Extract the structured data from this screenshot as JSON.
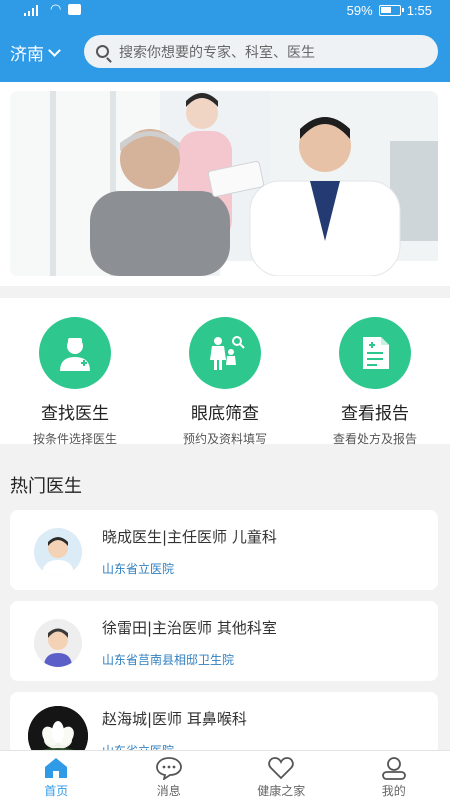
{
  "status": {
    "network": "4G",
    "battery": "59%",
    "time": "1:55"
  },
  "header": {
    "city": "济南",
    "search_placeholder": "搜索你想要的专家、科室、医生"
  },
  "features": [
    {
      "title": "查找医生",
      "subtitle": "按条件选择医生",
      "icon": "doctor-icon"
    },
    {
      "title": "眼底筛查",
      "subtitle": "预约及资料填写",
      "icon": "family-icon"
    },
    {
      "title": "查看报告",
      "subtitle": "查看处方及报告",
      "icon": "report-icon"
    }
  ],
  "hot_doctors": {
    "title": "热门医生",
    "items": [
      {
        "name": "晓成医生|主任医师 儿童科",
        "hospital": "山东省立医院"
      },
      {
        "name": "徐雷田|主治医师 其他科室",
        "hospital": "山东省莒南县相邸卫生院"
      },
      {
        "name": "赵海城|医师 耳鼻喉科",
        "hospital": "山东省立医院"
      }
    ]
  },
  "tabs": [
    {
      "label": "首页",
      "icon": "home-icon",
      "active": true
    },
    {
      "label": "消息",
      "icon": "message-icon",
      "active": false
    },
    {
      "label": "健康之家",
      "icon": "heart-icon",
      "active": false
    },
    {
      "label": "我的",
      "icon": "user-icon",
      "active": false
    }
  ],
  "colors": {
    "primary": "#2f9be7",
    "feature": "#2ec88f",
    "hospital_text": "#2f7fc0"
  }
}
